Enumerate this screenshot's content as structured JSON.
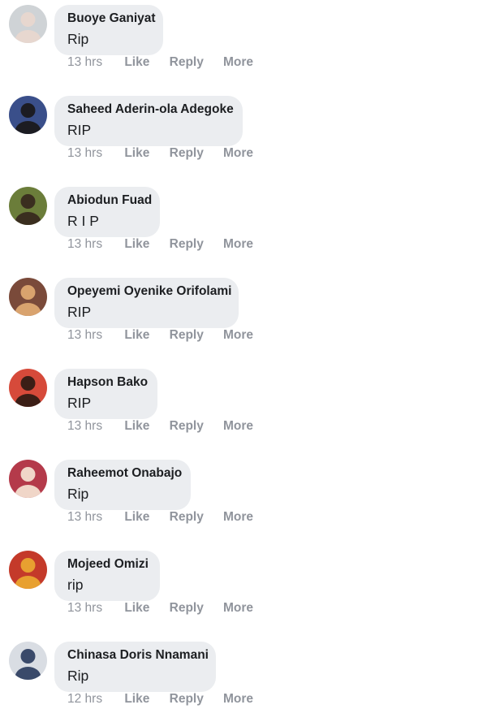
{
  "comments": [
    {
      "author": "Buoye Ganiyat",
      "text": "Rip",
      "time": "13 hrs",
      "avatar": "person-avatar",
      "bubble_width": 134
    },
    {
      "author": "Saheed Aderin-ola Adegoke",
      "text": "RIP",
      "time": "13 hrs",
      "avatar": "person-avatar",
      "bubble_width": 232
    },
    {
      "author": "Abiodun Fuad",
      "text": "R I P",
      "time": "13 hrs",
      "avatar": "person-avatar",
      "bubble_width": 130
    },
    {
      "author": "Opeyemi Oyenike Orifolami",
      "text": "RIP",
      "time": "13 hrs",
      "avatar": "person-avatar",
      "bubble_width": 227
    },
    {
      "author": "Hapson Bako",
      "text": "RIP",
      "time": "13 hrs",
      "avatar": "person-avatar",
      "bubble_width": 127
    },
    {
      "author": "Raheemot Onabajo",
      "text": "Rip",
      "time": "13 hrs",
      "avatar": "person-avatar",
      "bubble_width": 168
    },
    {
      "author": "Mojeed Omizi",
      "text": "rip",
      "time": "13 hrs",
      "avatar": "person-avatar",
      "bubble_width": 130
    },
    {
      "author": "Chinasa Doris Nnamani",
      "text": "Rip",
      "time": "12 hrs",
      "avatar": "person-avatar",
      "bubble_width": 199
    }
  ],
  "actions": {
    "like_label": "Like",
    "reply_label": "Reply",
    "more_label": "More"
  },
  "colors": {
    "bubble_bg": "#ebedf0",
    "author_text": "#1c1e21",
    "meta_text": "#90949c"
  },
  "avatar_palettes": [
    {
      "bg": "#cfd3d6",
      "fg": "#e7d7cf"
    },
    {
      "bg": "#3a4f8a",
      "fg": "#1c1c22"
    },
    {
      "bg": "#6b7d3a",
      "fg": "#3a2e1f"
    },
    {
      "bg": "#7a4a3a",
      "fg": "#d9a36e"
    },
    {
      "bg": "#d64a3a",
      "fg": "#3b1e16"
    },
    {
      "bg": "#b43a4a",
      "fg": "#f0d6c8"
    },
    {
      "bg": "#c43a2a",
      "fg": "#e8a030"
    },
    {
      "bg": "#d9dde3",
      "fg": "#3a4a6a"
    }
  ]
}
